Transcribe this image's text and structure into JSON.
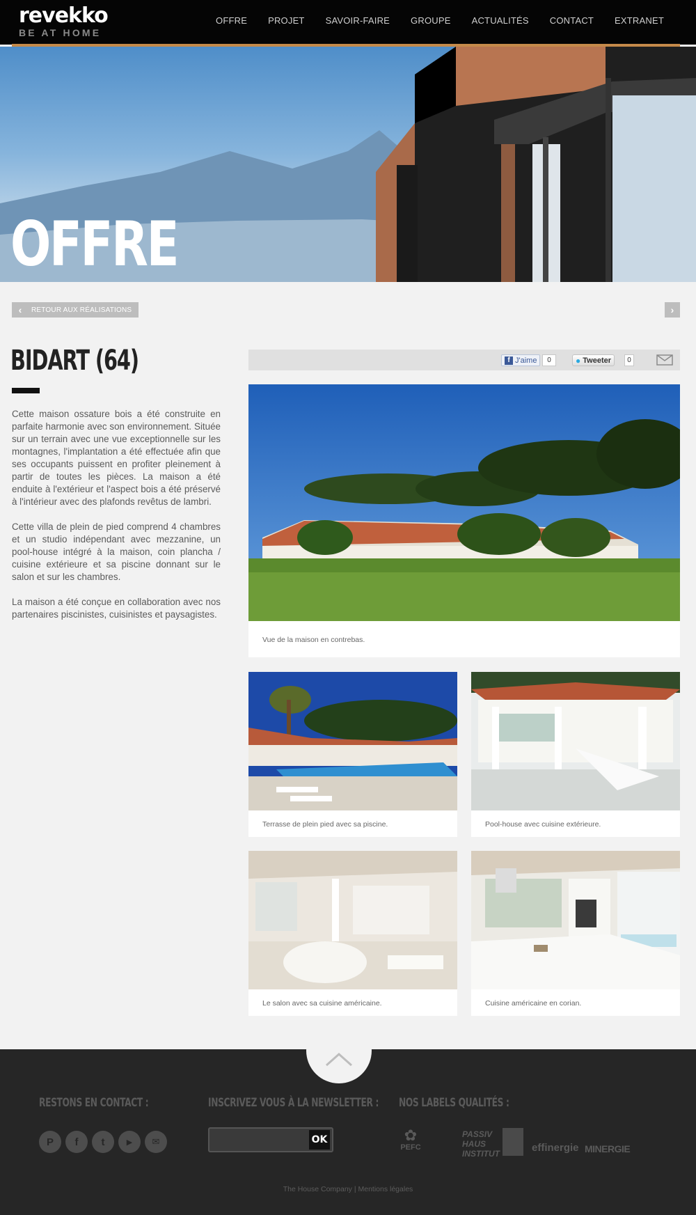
{
  "brand": {
    "name": "revekko",
    "tagline": "BE AT HOME"
  },
  "nav": {
    "items": [
      "OFFRE",
      "PROJET",
      "SAVOIR-FAIRE",
      "GROUPE",
      "ACTUALITÉS",
      "CONTACT",
      "EXTRANET"
    ]
  },
  "hero": {
    "title": "OFFRE"
  },
  "back": {
    "label": "RETOUR AUX RÉALISATIONS"
  },
  "project": {
    "title": "BIDART (64)",
    "paragraphs": [
      "Cette maison ossature bois a été construite en parfaite harmonie avec son environnement. Située sur un terrain avec une vue exceptionnelle sur les montagnes, l'implantation a été effectuée afin que ses occupants puissent en profiter pleinement à partir de toutes les pièces. La maison a été enduite à l'extérieur et l'aspect bois a été préservé à l'intérieur avec des plafonds revêtus de lambri.",
      "Cette villa de plein de pied comprend 4 chambres et un studio indépendant avec mezzanine, un pool-house intégré à la maison, coin plancha / cuisine extérieure et sa piscine donnant sur le salon et sur les chambres.",
      "La maison a été conçue en collaboration avec nos partenaires piscinistes, cuisinistes et paysagistes."
    ]
  },
  "share": {
    "like_label": "J'aime",
    "like_count": "0",
    "tweet_label": "Tweeter",
    "tweet_count": "0",
    "mail_icon": "mail-icon"
  },
  "photos": [
    {
      "caption": "Vue de la maison en contrebas."
    },
    {
      "caption": "Terrasse de plein pied avec sa piscine."
    },
    {
      "caption": "Pool-house avec cuisine extérieure."
    },
    {
      "caption": "Le salon avec sa cuisine américaine."
    },
    {
      "caption": "Cuisine américaine en corian."
    }
  ],
  "footer": {
    "contact_heading": "RESTONS EN CONTACT :",
    "newsletter_heading": "INSCRIVEZ VOUS À LA NEWSLETTER :",
    "labels_heading": "NOS LABELS QUALITÉS :",
    "newsletter_button": "OK",
    "social": [
      "pinterest-icon",
      "facebook-icon",
      "twitter-icon",
      "youtube-icon",
      "mail-icon"
    ],
    "labels": {
      "pefc": "PEFC",
      "passiv": [
        "PASSIV",
        "HAUS",
        "INSTITUT"
      ],
      "effinergie": "effinergie",
      "minergie": "MINERGIE"
    },
    "links": {
      "company": "The House Company",
      "separator": " | ",
      "legal": "Mentions légales"
    }
  },
  "colors": {
    "header_bg": "#050505",
    "accent": "#c58a4a",
    "footer_bg": "#262626",
    "page_bg": "#f2f2f2"
  }
}
